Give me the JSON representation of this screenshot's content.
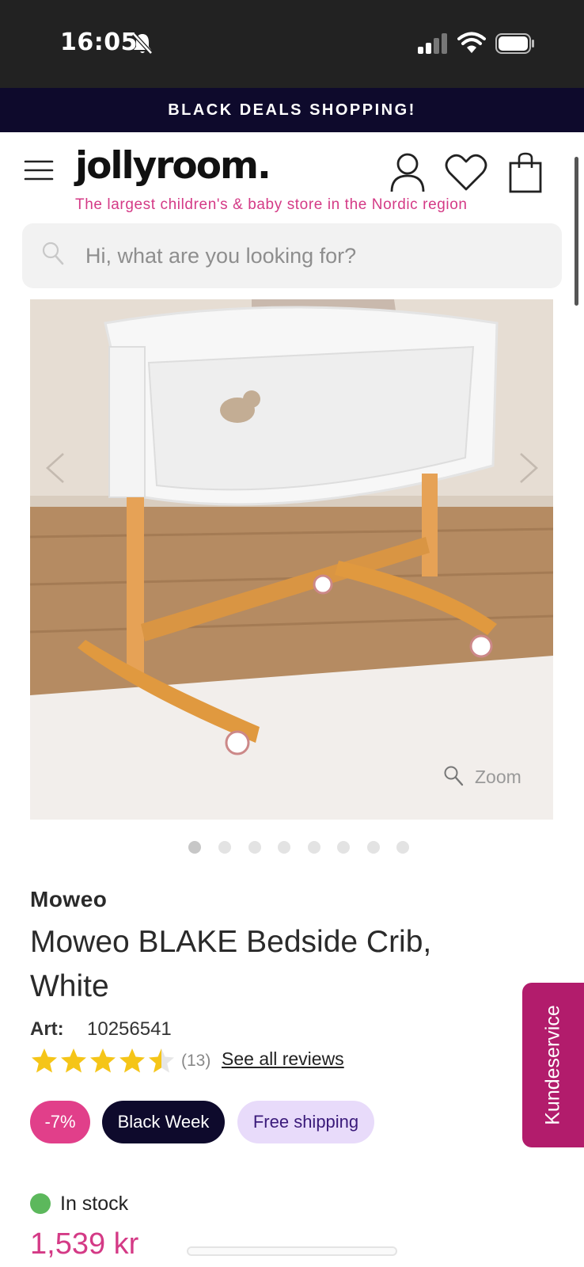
{
  "status_bar": {
    "time": "16:05",
    "icons": [
      "bell-off-icon",
      "signal-icon",
      "wifi-icon",
      "battery-icon"
    ]
  },
  "promo_banner": {
    "text": "BLACK DEALS SHOPPING!"
  },
  "header": {
    "logo": "jollyroom.",
    "tagline": "The largest children's & baby store in the Nordic region",
    "icons": [
      "menu-icon",
      "account-icon",
      "heart-icon",
      "shopping-bag-icon"
    ]
  },
  "search": {
    "placeholder": "Hi, what are you looking for?",
    "value": ""
  },
  "gallery": {
    "zoom_label": "Zoom",
    "image_count": 8,
    "active_index": 0
  },
  "product": {
    "brand": "Moweo",
    "title": "Moweo BLAKE Bedside Crib, White",
    "art_label": "Art:",
    "art_number": "10256541",
    "rating": 4.5,
    "review_count": "(13)",
    "see_reviews": "See all reviews"
  },
  "badges": {
    "discount": "-7%",
    "campaign": "Black Week",
    "shipping": "Free shipping"
  },
  "customer_service": {
    "label": "Kundeservice"
  },
  "availability": {
    "status": "In stock",
    "price": "1,539 kr"
  },
  "colors": {
    "brand_pink": "#d43a86",
    "banner_navy": "#0e0a2c",
    "service_magenta": "#b21c6c",
    "stock_green": "#5cb85c",
    "shipping_lavender": "#e8dbfa",
    "star_yellow": "#f5c518"
  }
}
